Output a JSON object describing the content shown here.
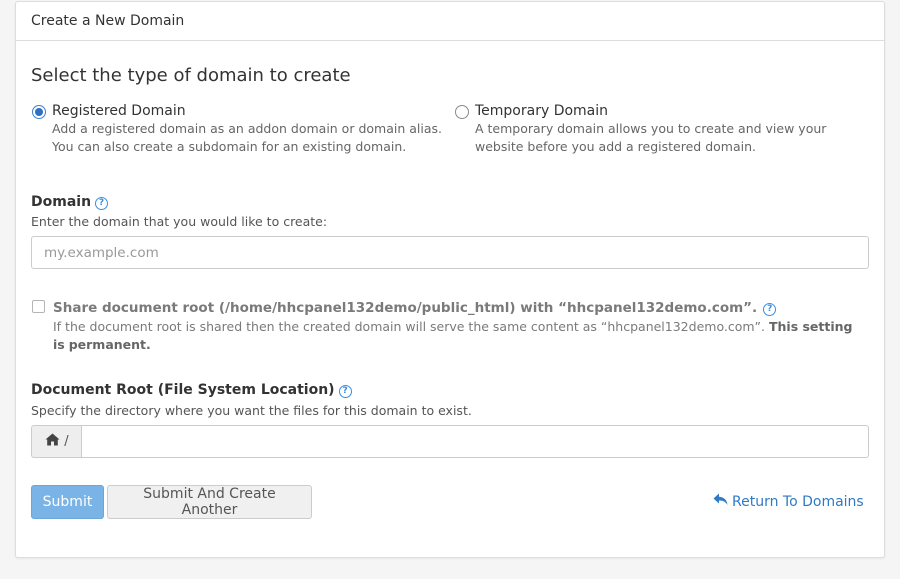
{
  "panel": {
    "title": "Create a New Domain"
  },
  "section_title": "Select the type of domain to create",
  "domain_types": [
    {
      "title": "Registered Domain",
      "checked": true,
      "desc_line1": "Add a registered domain as an addon domain or domain alias.",
      "desc_line2": "You can also create a subdomain for an existing domain."
    },
    {
      "title": "Temporary Domain",
      "checked": false,
      "desc_line1": "A temporary domain allows you to create and view your",
      "desc_line2": "website before you add a registered domain."
    }
  ],
  "domain_field": {
    "label": "Domain",
    "help_glyph": "?",
    "hint": "Enter the domain that you would like to create:",
    "placeholder": "my.example.com",
    "value": ""
  },
  "share_root": {
    "label": "Share document root (/home/hhcpanel132demo/public_html) with “hhcpanel132demo.com”.",
    "note_part1": "If the document root is shared then the created domain will serve the same content as “hhcpanel132demo.com”.",
    "note_bold1": "This setting is",
    "note_bold2": "permanent.",
    "checked": false,
    "disabled": true
  },
  "docroot_field": {
    "label": "Document Root (File System Location)",
    "hint": "Specify the directory where you want the files for this domain to exist.",
    "addon_icon": "home-icon",
    "addon_text": "/",
    "value": ""
  },
  "buttons": {
    "submit": "Submit",
    "submit_another": "Submit And Create Another",
    "return_link": "Return To Domains",
    "return_icon": "reply-icon"
  },
  "colors": {
    "accent": "#2f7ac4",
    "primary_button": "#7ab3e6",
    "help_icon": "#3a8ee6"
  }
}
